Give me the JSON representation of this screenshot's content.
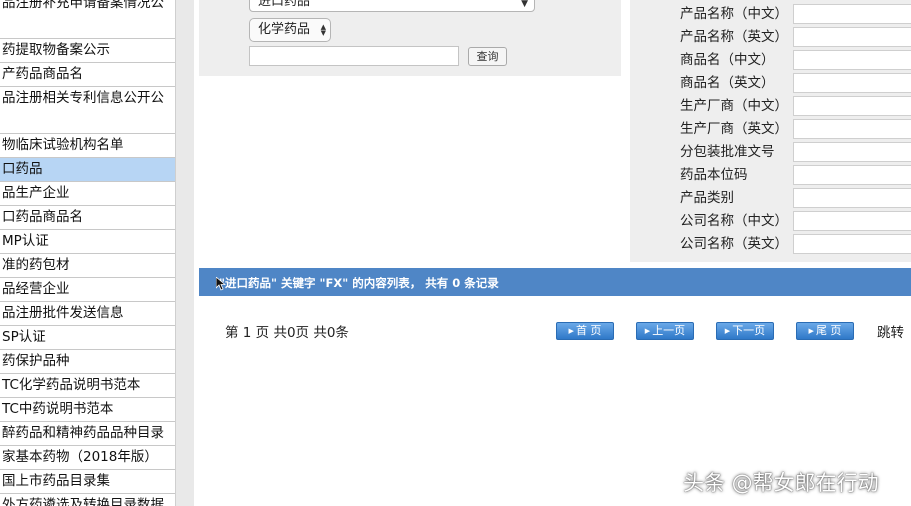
{
  "sidebar": {
    "items": [
      {
        "label": "品注册补充申请备案情况公",
        "selected": false
      },
      {
        "label": "药提取物备案公示",
        "selected": false
      },
      {
        "label": "产药品商品名",
        "selected": false
      },
      {
        "label": "品注册相关专利信息公开公",
        "selected": false
      },
      {
        "label": "物临床试验机构名单",
        "selected": false
      },
      {
        "label": "口药品",
        "selected": true
      },
      {
        "label": "品生产企业",
        "selected": false
      },
      {
        "label": "口药品商品名",
        "selected": false
      },
      {
        "label": "MP认证",
        "selected": false
      },
      {
        "label": "准的药包材",
        "selected": false
      },
      {
        "label": "品经营企业",
        "selected": false
      },
      {
        "label": "品注册批件发送信息",
        "selected": false
      },
      {
        "label": "SP认证",
        "selected": false
      },
      {
        "label": "药保护品种",
        "selected": false
      },
      {
        "label": "TC化学药品说明书范本",
        "selected": false
      },
      {
        "label": "TC中药说明书范本",
        "selected": false
      },
      {
        "label": "醉药品和精神药品品种目录",
        "selected": false
      },
      {
        "label": "家基本药物（2018年版）",
        "selected": false
      },
      {
        "label": "国上市药品目录集",
        "selected": false
      },
      {
        "label": "外方药遴选及转换目录数据",
        "selected": false
      }
    ]
  },
  "search": {
    "category_value": "进口药品",
    "type_value": "化学药品",
    "keyword_value": "",
    "query_label": "查询"
  },
  "advanced": {
    "fields": [
      {
        "label": "产品名称（中文）",
        "value": ""
      },
      {
        "label": "产品名称（英文）",
        "value": ""
      },
      {
        "label": "商品名（中文）",
        "value": ""
      },
      {
        "label": "商品名（英文）",
        "value": ""
      },
      {
        "label": "生产厂商（中文）",
        "value": ""
      },
      {
        "label": "生产厂商（英文）",
        "value": ""
      },
      {
        "label": "分包装批准文号",
        "value": ""
      },
      {
        "label": "药品本位码",
        "value": ""
      },
      {
        "label": "产品类别",
        "value": ""
      },
      {
        "label": "公司名称（中文）",
        "value": ""
      },
      {
        "label": "公司名称（英文）",
        "value": ""
      }
    ]
  },
  "results": {
    "summary": "\"进口药品\" 关键字 \"FX\" 的内容列表， 共有 0 条记录"
  },
  "pager": {
    "info": "第 1 页 共0页 共0条",
    "first_label": "首 页",
    "prev_label": "上一页",
    "next_label": "下一页",
    "last_label": "尾 页",
    "jump_label": "跳转"
  },
  "watermark": "头条 @帮女郎在行动",
  "colors": {
    "results_bar": "#4f86c6",
    "selected_item": "#b7d5f4",
    "panel_bg": "#eeeeee"
  },
  "icons": {
    "cursor": "mouse-pointer-icon",
    "pager_arrow": "play-triangle-icon",
    "select_chevron": "chevron-down-icon"
  }
}
